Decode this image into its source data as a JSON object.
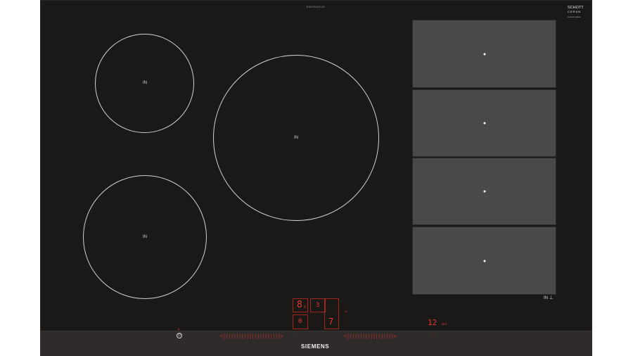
{
  "hob": {
    "model_number": "EX875LEC1E",
    "glass_brand": "SCHOTT",
    "glass_brand_sub": "CERAN",
    "glass_brand_small": "ceramic glass",
    "brand": "SIEMENS",
    "colors": {
      "glass": "#1b1918",
      "strip": "#2e2b2a",
      "accent": "#e0362a",
      "zone_outline": "#d4d0cc"
    }
  },
  "zones": [
    {
      "label": "IN"
    },
    {
      "label": "IN"
    },
    {
      "label": "IN"
    }
  ],
  "flex_zone": {
    "label": "IN",
    "icon": "flex-zone-icon",
    "sections": 4
  },
  "controls": {
    "power_icon": "power-icon",
    "power_symbol": "⏻",
    "left_slider": "<||||||||||||||||||||||>",
    "right_slider": "<||||||||||||||||||>",
    "display_power_level": "8",
    "display_power_sub": "5",
    "display_zone": "0",
    "display_mid": "3",
    "display_big": "7",
    "timer_value": "12",
    "timer_unit": "min",
    "indicator_plus": "+",
    "indicator_minus": "-"
  }
}
